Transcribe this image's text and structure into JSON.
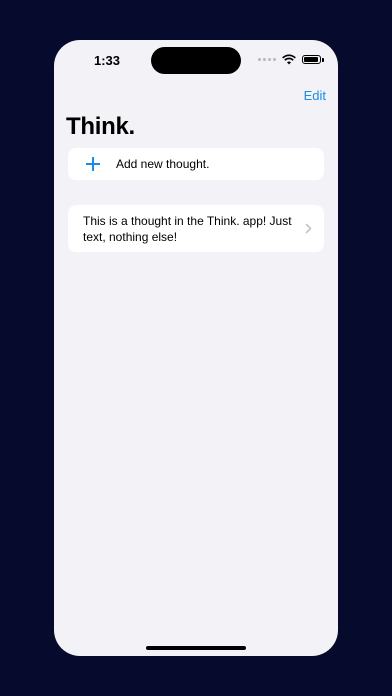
{
  "status": {
    "time": "1:33"
  },
  "nav": {
    "edit_label": "Edit"
  },
  "title": "Think.",
  "add_row": {
    "label": "Add new thought.",
    "icon": "plus-icon"
  },
  "thoughts": [
    {
      "text": "This is a thought in the Think. app! Just text, nothing else!"
    }
  ],
  "colors": {
    "accent": "#1a8be6",
    "background": "#f2f2f7",
    "outer": "#060b2e"
  }
}
